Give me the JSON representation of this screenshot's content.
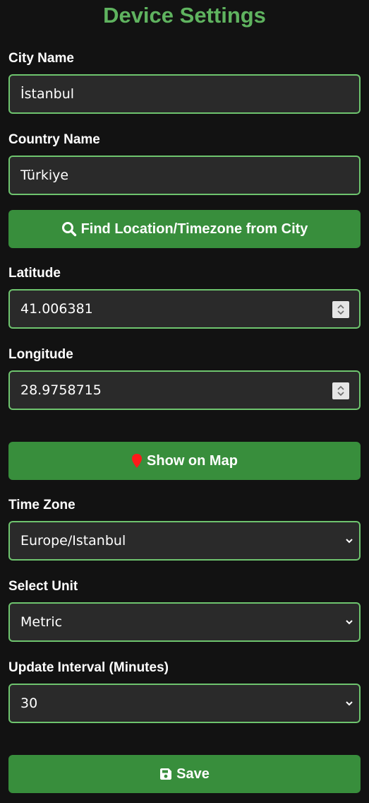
{
  "page": {
    "title": "Device Settings"
  },
  "city": {
    "label": "City Name",
    "value": "İstanbul"
  },
  "country": {
    "label": "Country Name",
    "value": "Türkiye"
  },
  "find_button": {
    "label": "Find Location/Timezone from City",
    "icon": "search-icon"
  },
  "latitude": {
    "label": "Latitude",
    "value": "41.006381"
  },
  "longitude": {
    "label": "Longitude",
    "value": "28.9758715"
  },
  "map_button": {
    "label": "Show on Map",
    "icon": "map-pin-icon"
  },
  "timezone": {
    "label": "Time Zone",
    "selected": "Europe/Istanbul"
  },
  "unit": {
    "label": "Select Unit",
    "selected": "Metric"
  },
  "interval": {
    "label": "Update Interval (Minutes)",
    "selected": "30"
  },
  "save_button": {
    "label": "Save",
    "icon": "floppy-disk-icon"
  },
  "colors": {
    "background": "#121212",
    "title": "#5fb35f",
    "input_bg": "#2a2a2a",
    "input_border": "#6ec46e",
    "button": "#388e3c",
    "map_pin": "#ff1a1a"
  }
}
